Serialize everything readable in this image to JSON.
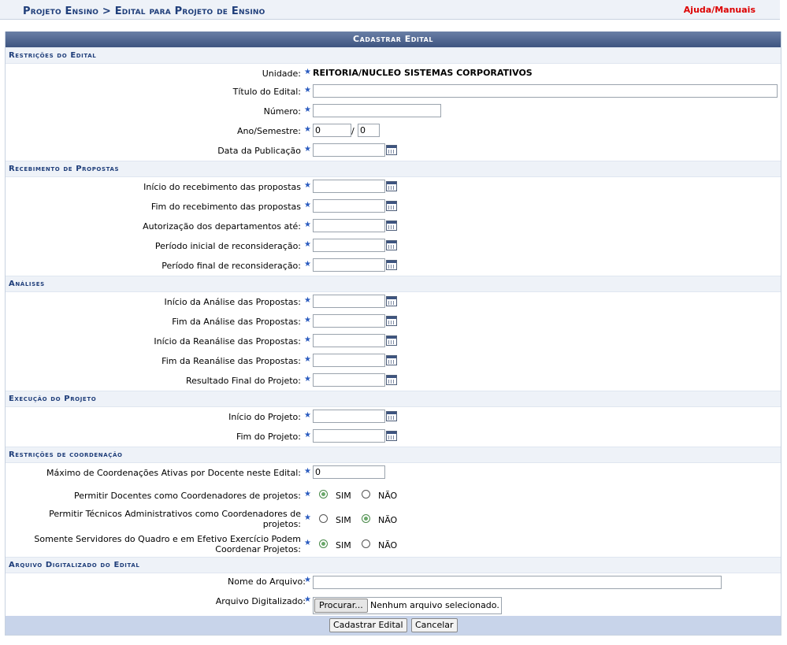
{
  "header": {
    "breadcrumb": "Projeto Ensino > Edital para Projeto de Ensino",
    "help_link": "Ajuda/Manuais"
  },
  "form": {
    "caption": "Cadastrar Edital",
    "required_mark": "★",
    "sections": {
      "restricoes": {
        "title": "Restrições do Edital",
        "unidade_label": "Unidade:",
        "unidade_value": "REITORIA/NUCLEO SISTEMAS CORPORATIVOS",
        "titulo_label": "Título do Edital:",
        "titulo_value": "",
        "numero_label": "Número:",
        "numero_value": "",
        "ano_label": "Ano/Semestre:",
        "ano_value": "0",
        "ano_sep": "/",
        "semestre_value": "0",
        "publicacao_label": "Data da Publicação"
      },
      "recebimento": {
        "title": "Recebimento de Propostas",
        "fields": [
          "Início do recebimento das propostas",
          "Fim do recebimento das propostas",
          "Autorização dos departamentos até:",
          "Período inicial de reconsideração:",
          "Período final de reconsideração:"
        ]
      },
      "analises": {
        "title": "Análises",
        "fields": [
          "Início da Análise das Propostas:",
          "Fim da Análise das Propostas:",
          "Início da Reanálise das Propostas:",
          "Fim da Reanálise das Propostas:",
          "Resultado Final do Projeto:"
        ]
      },
      "execucao": {
        "title": "Execução do Projeto",
        "fields": [
          "Início do Projeto:",
          "Fim do Projeto:"
        ]
      },
      "coordenacao": {
        "title": "Restrições de coordenação",
        "max_label": "Máximo de Coordenações Ativas por Docente neste Edital:",
        "max_value": "0",
        "docentes_label": "Permitir Docentes como Coordenadores de projetos:",
        "docentes_selected": "SIM",
        "tecnicos_label_1": "Permitir Técnicos Administrativos como Coordenadores de",
        "tecnicos_label_2": "projetos:",
        "tecnicos_selected": "NÃO",
        "servidores_label_1": "Somente Servidores do Quadro e em Efetivo Exercício Podem",
        "servidores_label_2": "Coordenar Projetos:",
        "servidores_selected": "SIM",
        "yes": "SIM",
        "no": "NÃO"
      },
      "arquivo": {
        "title": "Arquivo Digitalizado do Edital",
        "nome_label": "Nome do Arquivo:",
        "nome_value": "",
        "arquivo_label": "Arquivo Digitalizado:",
        "browse_button": "Procurar...",
        "no_file": "Nenhum arquivo selecionado."
      }
    },
    "buttons": {
      "submit": "Cadastrar Edital",
      "cancel": "Cancelar"
    }
  },
  "colors": {
    "header_text": "#1f3e7a",
    "help_link": "#dd0000",
    "caption_bg": "#3d5480",
    "required_star": "#2a5bbf"
  },
  "icons": {
    "date_picker": "calendar-icon",
    "required": "required-star-icon"
  }
}
